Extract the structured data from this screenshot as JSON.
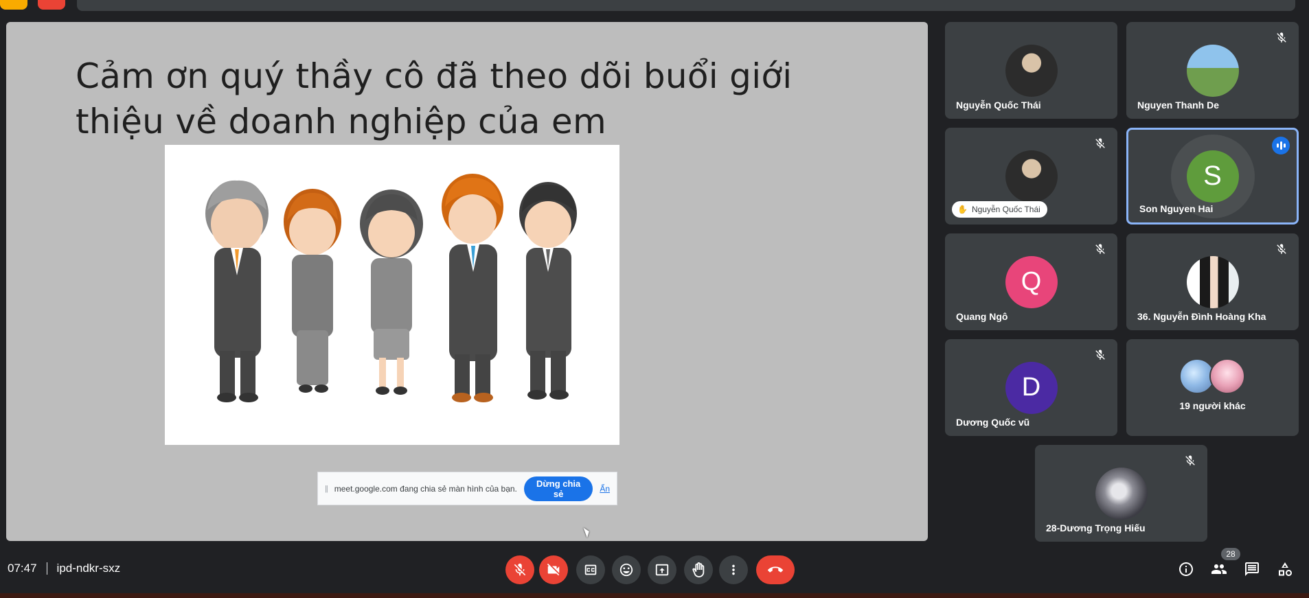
{
  "meeting": {
    "time": "07:47",
    "code": "ipd-ndkr-sxz",
    "participant_count": "28"
  },
  "slide": {
    "title": "Cảm ơn quý thầy cô đã theo dõi buổi giới thiệu về doanh nghiệp của em"
  },
  "share_banner": {
    "message": "meet.google.com đang chia sẻ màn hình của bạn.",
    "stop_label": "Dừng chia sẻ",
    "hide_label": "Ẩn"
  },
  "tiles": [
    {
      "name": "Nguyễn Quốc Thái",
      "muted": false,
      "avatar": "photo"
    },
    {
      "name": "Nguyen Thanh De",
      "muted": true,
      "avatar": "photo"
    },
    {
      "name": "Nguyễn Quốc Thái",
      "muted": true,
      "avatar": "photo",
      "presenting_label": "Nguyễn Quốc Thái"
    },
    {
      "name": "Son Nguyen Hai",
      "muted": false,
      "speaking": true,
      "initial": "S",
      "color": "#5f9c3c"
    },
    {
      "name": "Quang Ngô",
      "muted": true,
      "initial": "Q",
      "color": "#e8457a"
    },
    {
      "name": "36. Nguyễn Đình Hoàng Kha",
      "muted": true,
      "avatar": "photo"
    },
    {
      "name": "Dương Quốc vũ",
      "muted": true,
      "initial": "D",
      "color": "#4b2aa3"
    },
    {
      "name": "19 người khác",
      "others": true
    },
    {
      "name": "28-Dương Trọng Hiếu",
      "muted": true,
      "avatar": "photo"
    }
  ],
  "controls": {
    "mic": "mic-off-icon",
    "camera": "camera-off-icon",
    "captions": "captions-icon",
    "emoji": "emoji-icon",
    "present": "present-icon",
    "raise_hand": "hand-icon",
    "more": "more-options-icon",
    "leave": "end-call-icon"
  },
  "colors": {
    "background": "#202124",
    "tile": "#3c4043",
    "red": "#ea4335",
    "blue": "#1a73e8"
  }
}
